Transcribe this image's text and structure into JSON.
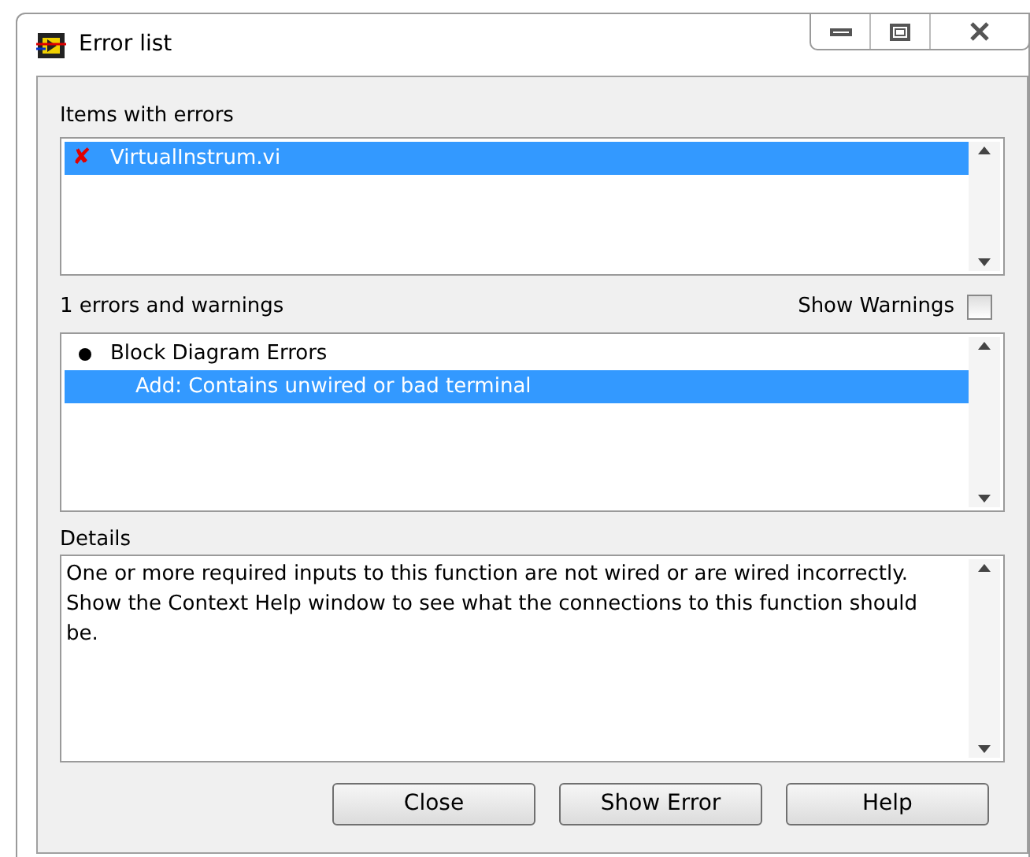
{
  "window": {
    "title": "Error list"
  },
  "items_with_errors": {
    "label": "Items with errors",
    "items": [
      {
        "glyph": "✘",
        "name": "VirtualInstrum.vi",
        "selected": true
      }
    ]
  },
  "errors": {
    "label": "1 errors and warnings",
    "show_warnings": {
      "label": "Show Warnings",
      "checked": false
    },
    "items": [
      {
        "kind": "group",
        "text": "Block Diagram Errors",
        "selected": false
      },
      {
        "kind": "error",
        "text": "Add: Contains unwired or bad terminal",
        "selected": true
      }
    ]
  },
  "details": {
    "label": "Details",
    "text": "One or more required inputs to this function are not wired or are wired incorrectly. Show the Context Help window to see what the connections to this function should be."
  },
  "buttons": [
    "Close",
    "Show Error",
    "Help"
  ]
}
